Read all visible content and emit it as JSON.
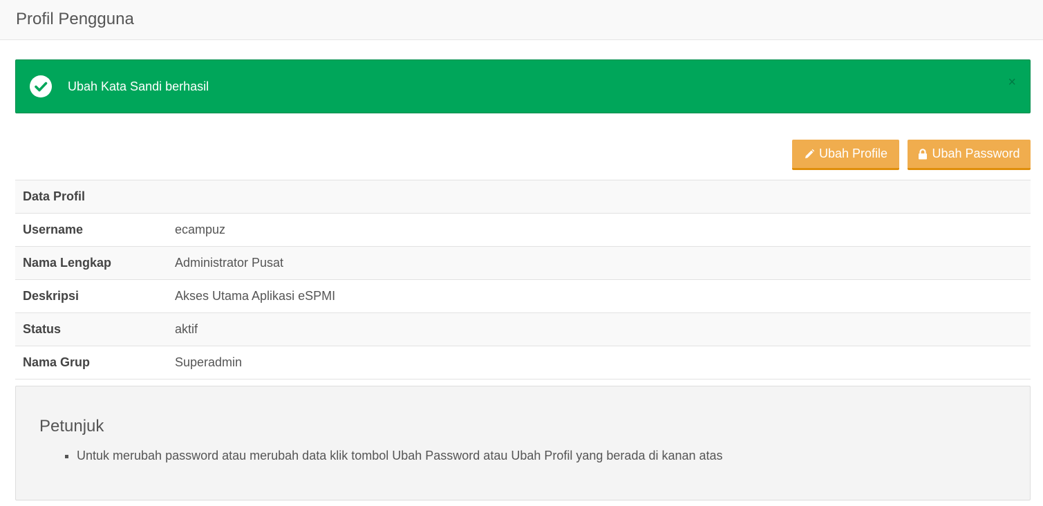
{
  "header": {
    "title": "Profil Pengguna"
  },
  "alert": {
    "message": "Ubah Kata Sandi berhasil",
    "close_symbol": "×",
    "icon": "check-circle-icon",
    "color": "#00a65a"
  },
  "actions": {
    "edit_profile_label": "Ubah Profile",
    "edit_profile_icon": "pencil-icon",
    "change_password_label": "Ubah Password",
    "change_password_icon": "lock-icon",
    "color": "#f0ad4e"
  },
  "profile": {
    "section_title": "Data Profil",
    "rows": [
      {
        "label": "Username",
        "value": "ecampuz"
      },
      {
        "label": "Nama Lengkap",
        "value": "Administrator Pusat"
      },
      {
        "label": "Deskripsi",
        "value": "Akses Utama Aplikasi eSPMI"
      },
      {
        "label": "Status",
        "value": "aktif"
      },
      {
        "label": "Nama Grup",
        "value": "Superadmin"
      }
    ]
  },
  "instructions": {
    "title": "Petunjuk",
    "items": [
      "Untuk merubah password atau merubah data klik tombol Ubah Password atau Ubah Profil yang berada di kanan atas"
    ]
  }
}
